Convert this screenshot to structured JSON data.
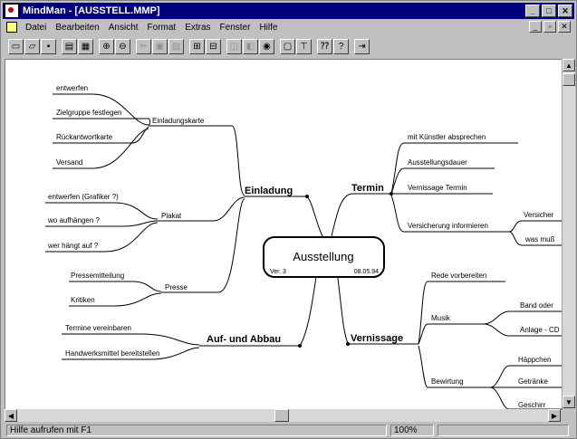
{
  "window": {
    "title": "MindMan - [AUSSTELL.MMP]"
  },
  "menubar": {
    "items": [
      "Datei",
      "Bearbeiten",
      "Ansicht",
      "Format",
      "Extras",
      "Fenster",
      "Hilfe"
    ]
  },
  "toolbar": {
    "buttons": [
      "new-file-icon",
      "open-folder-icon",
      "save-icon",
      "print-icon",
      "print-preview-icon",
      "zoom-in-icon",
      "zoom-out-icon",
      "cut-icon",
      "copy-icon",
      "paste-icon",
      "insert-branch-icon",
      "delete-branch-icon",
      "expand-icon",
      "collapse-icon",
      "center-icon",
      "properties-icon",
      "outline-icon",
      "help-context-icon",
      "help-icon",
      "exit-icon"
    ]
  },
  "mindmap": {
    "center": {
      "title": "Ausstellung",
      "version": "Ver. 3",
      "date": "08.05.94"
    },
    "branches": [
      {
        "label": "Einladung",
        "children": [
          {
            "label": "Einladungskarte",
            "children": [
              "entwerfen",
              "Zielgruppe festlegen",
              "Rückantwortkarte",
              "Versand"
            ]
          },
          {
            "label": "Plakat",
            "children": [
              "entwerfen (Grafiker ?)",
              "wo aufhängen ?",
              "wer hängt auf ?"
            ]
          },
          {
            "label": "Presse",
            "children": [
              "Pressemitteilung",
              "Kritiken"
            ]
          }
        ]
      },
      {
        "label": "Auf- und Abbau",
        "children": [
          "Termine vereinbaren",
          "Handwerksmittel bereitstellen"
        ]
      },
      {
        "label": "Termin",
        "children": [
          "mit Künstler absprechen",
          "Ausstellungsdauer",
          "Vernissage Termin",
          {
            "label": "Versicherung informieren",
            "children": [
              "Versicher",
              "was muß"
            ]
          }
        ]
      },
      {
        "label": "Vernissage",
        "children": [
          "Rede vorbereiten",
          {
            "label": "Musik",
            "children": [
              "Band oder",
              "Anlage - CD"
            ]
          },
          {
            "label": "Bewirtung",
            "children": [
              "Häppchen",
              "Getränke",
              "Geschirr"
            ]
          }
        ]
      }
    ]
  },
  "statusbar": {
    "help_text": "Hilfe aufrufen mit F1",
    "zoom": "100%"
  },
  "colors": {
    "titlebar": "#000080",
    "chrome": "#c0c0c0",
    "canvas": "#ffffff"
  }
}
